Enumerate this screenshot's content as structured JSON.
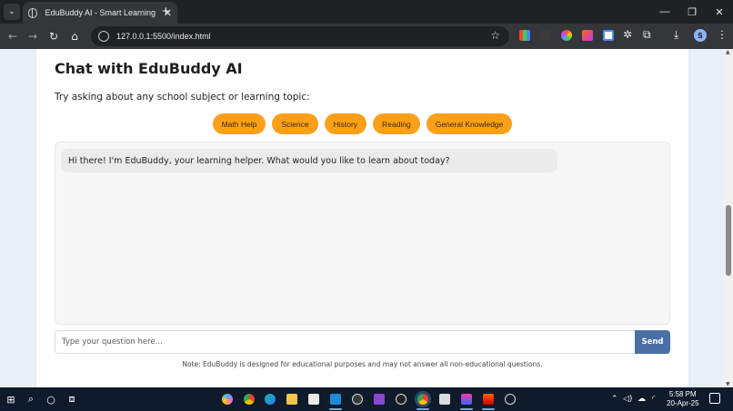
{
  "browser": {
    "tab_title": "EduBuddy AI - Smart Learning C",
    "tab_close": "✕",
    "new_tab": "+",
    "url": "127.0.0.1:5500/index.html",
    "window_controls": {
      "minimize": "—",
      "restore": "❐",
      "close": "✕"
    }
  },
  "page": {
    "title": "Chat with EduBuddy AI",
    "subtitle": "Try asking about any school subject or learning topic:",
    "topics": [
      "Math Help",
      "Science",
      "History",
      "Reading",
      "General Knowledge"
    ],
    "messages": [
      {
        "sender": "bot",
        "text": "Hi there! I'm EduBuddy, your learning helper. What would you like to learn about today?"
      }
    ],
    "input_placeholder": "Type your question here...",
    "input_value": "",
    "send_label": "Send",
    "note": "Note: EduBuddy is designed for educational purposes and may not answer all non-educational questions."
  },
  "taskbar": {
    "time": "5:58 PM",
    "date": "20-Apr-25"
  },
  "colors": {
    "accent_chip": "#fca019",
    "send_button": "#4a6fa5",
    "page_background": "#e8f1fa"
  }
}
